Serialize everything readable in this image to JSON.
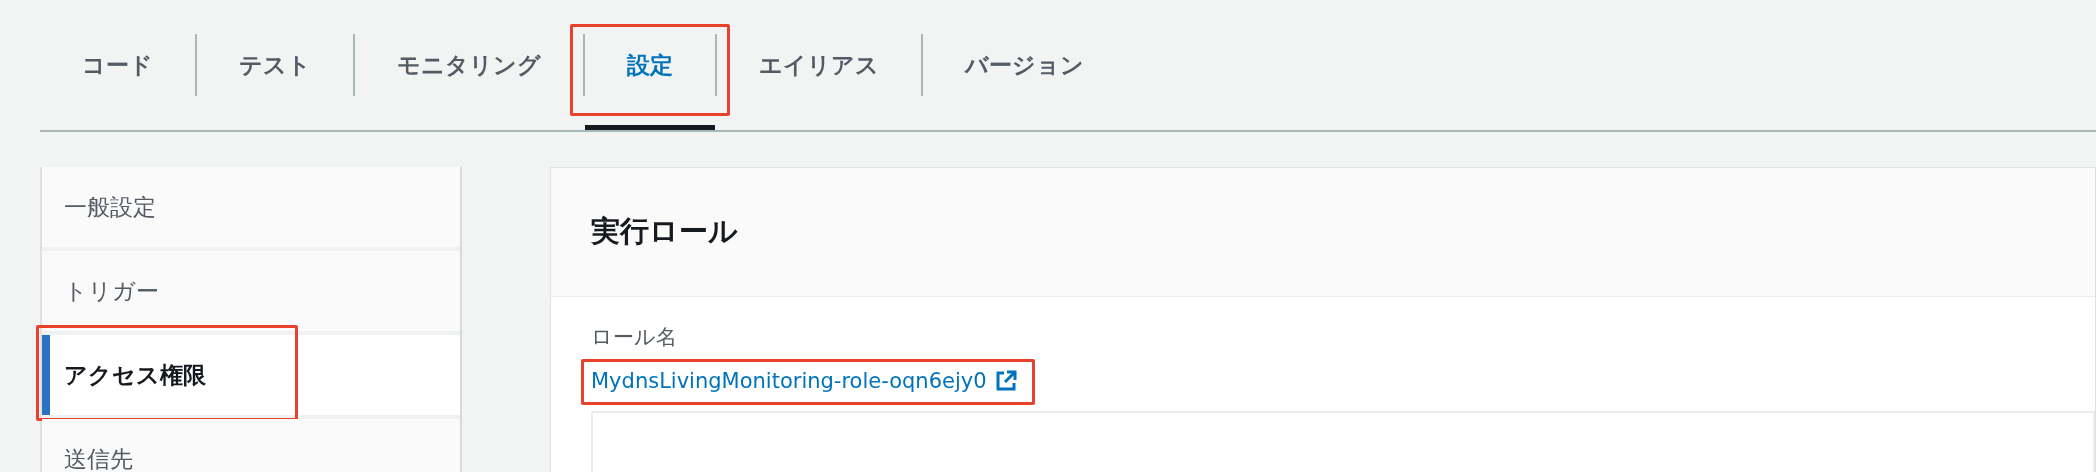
{
  "tabs": [
    {
      "label": "コード",
      "selected": false,
      "highlighted": false
    },
    {
      "label": "テスト",
      "selected": false,
      "highlighted": false
    },
    {
      "label": "モニタリング",
      "selected": false,
      "highlighted": false
    },
    {
      "label": "設定",
      "selected": true,
      "highlighted": true
    },
    {
      "label": "エイリアス",
      "selected": false,
      "highlighted": false
    },
    {
      "label": "バージョン",
      "selected": false,
      "highlighted": false
    }
  ],
  "sidebar": {
    "items": [
      {
        "label": "一般設定",
        "selected": false,
        "highlighted": false
      },
      {
        "label": "トリガー",
        "selected": false,
        "highlighted": false
      },
      {
        "label": "アクセス権限",
        "selected": true,
        "highlighted": true
      },
      {
        "label": "送信先",
        "selected": false,
        "highlighted": false
      }
    ]
  },
  "panel": {
    "title": "実行ロール",
    "field_label": "ロール名",
    "role_link": {
      "text": "MydnsLivingMonitoring-role-oqn6ejy0",
      "highlighted": true
    }
  }
}
